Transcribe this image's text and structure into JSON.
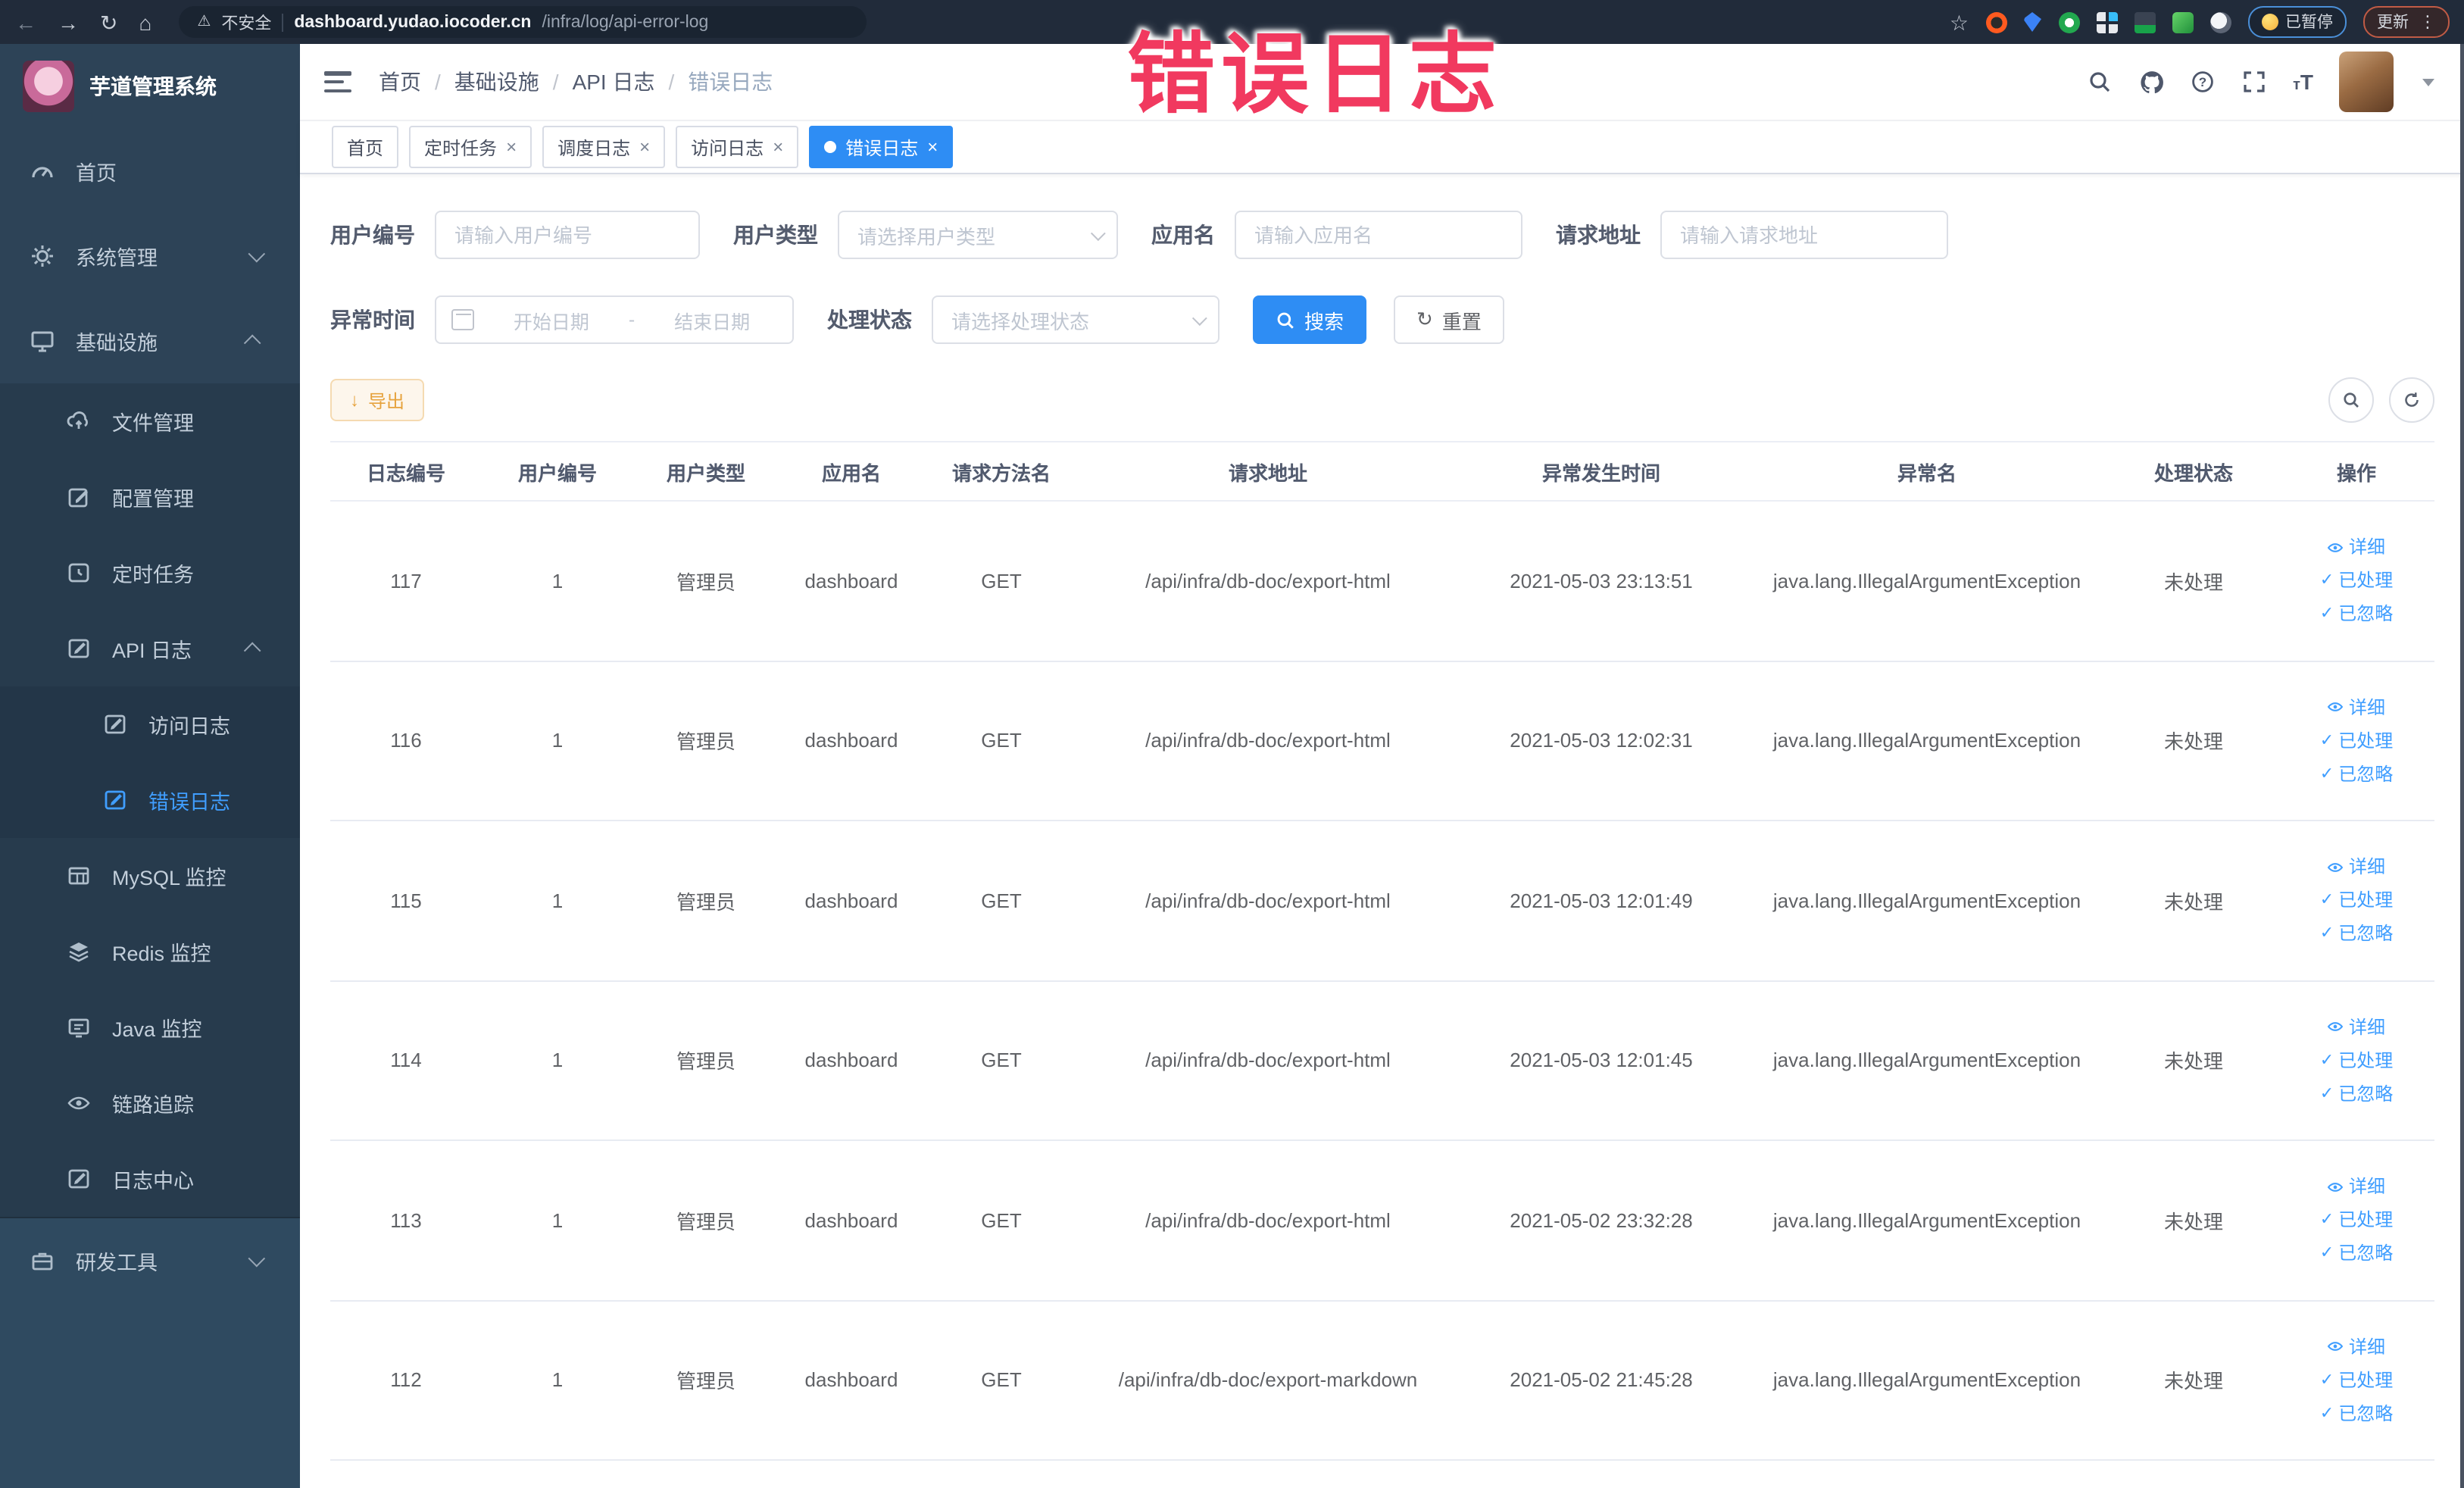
{
  "browser": {
    "security_label": "不安全",
    "url_domain": "dashboard.yudao.iocoder.cn",
    "url_path": "/infra/log/api-error-log",
    "back_icon": "←",
    "forward_icon": "→",
    "reload_icon": "↻",
    "home_icon": "⌂",
    "warning_icon": "⚠",
    "star_icon": "☆",
    "paused_label": "已暂停",
    "update_label": "更新",
    "kebab_icon": "⋮"
  },
  "overlay": {
    "title": "错误日志",
    "color": "#f1395f"
  },
  "sidebar": {
    "app_title": "芋道管理系统",
    "logo_icon": "rabbit-logo",
    "items": [
      {
        "label": "首页",
        "icon": "gauge-icon"
      },
      {
        "label": "系统管理",
        "icon": "gear-icon",
        "arrow": "down"
      },
      {
        "label": "基础设施",
        "icon": "monitor-icon",
        "arrow": "up"
      },
      {
        "label": "文件管理",
        "icon": "cloud-upload-icon"
      },
      {
        "label": "配置管理",
        "icon": "edit-icon"
      },
      {
        "label": "定时任务",
        "icon": "timer-icon"
      },
      {
        "label": "API 日志",
        "icon": "log-icon",
        "arrow": "up"
      },
      {
        "label": "访问日志",
        "icon": "log-icon"
      },
      {
        "label": "错误日志",
        "icon": "log-icon",
        "active": true
      },
      {
        "label": "MySQL 监控",
        "icon": "table-icon"
      },
      {
        "label": "Redis 监控",
        "icon": "layers-icon"
      },
      {
        "label": "Java 监控",
        "icon": "display-icon"
      },
      {
        "label": "链路追踪",
        "icon": "eye-icon"
      },
      {
        "label": "日志中心",
        "icon": "log-icon"
      },
      {
        "label": "研发工具",
        "icon": "briefcase-icon",
        "arrow": "down"
      }
    ]
  },
  "breadcrumb": {
    "separator": "/",
    "items": [
      "首页",
      "基础设施",
      "API 日志",
      "错误日志"
    ]
  },
  "tags": [
    {
      "label": "首页"
    },
    {
      "label": "定时任务",
      "close": "×"
    },
    {
      "label": "调度日志",
      "close": "×"
    },
    {
      "label": "访问日志",
      "close": "×"
    },
    {
      "label": "错误日志",
      "close": "×",
      "active": true
    }
  ],
  "filters": {
    "user_id": {
      "label": "用户编号",
      "placeholder": "请输入用户编号"
    },
    "user_type": {
      "label": "用户类型",
      "placeholder": "请选择用户类型"
    },
    "app_name": {
      "label": "应用名",
      "placeholder": "请输入应用名"
    },
    "request_url": {
      "label": "请求地址",
      "placeholder": "请输入请求地址"
    },
    "exception_time": {
      "label": "异常时间",
      "start_placeholder": "开始日期",
      "separator": "-",
      "end_placeholder": "结束日期"
    },
    "process_status": {
      "label": "处理状态",
      "placeholder": "请选择处理状态"
    },
    "search_label": "搜索",
    "reset_label": "重置"
  },
  "toolbar": {
    "export_label": "导出",
    "export_icon": "↓",
    "reset_icon": "↻"
  },
  "table": {
    "columns": [
      "日志编号",
      "用户编号",
      "用户类型",
      "应用名",
      "请求方法名",
      "请求地址",
      "异常发生时间",
      "异常名",
      "处理状态",
      "操作"
    ],
    "actions": {
      "detail": "详细",
      "processed": "已处理",
      "ignored": "已忽略",
      "check_icon": "✓"
    },
    "rows": [
      {
        "id": "117",
        "user_id": "1",
        "user_type": "管理员",
        "app_name": "dashboard",
        "method": "GET",
        "url": "/api/infra/db-doc/export-html",
        "time": "2021-05-03 23:13:51",
        "exception": "java.lang.IllegalArgumentException",
        "status": "未处理"
      },
      {
        "id": "116",
        "user_id": "1",
        "user_type": "管理员",
        "app_name": "dashboard",
        "method": "GET",
        "url": "/api/infra/db-doc/export-html",
        "time": "2021-05-03 12:02:31",
        "exception": "java.lang.IllegalArgumentException",
        "status": "未处理"
      },
      {
        "id": "115",
        "user_id": "1",
        "user_type": "管理员",
        "app_name": "dashboard",
        "method": "GET",
        "url": "/api/infra/db-doc/export-html",
        "time": "2021-05-03 12:01:49",
        "exception": "java.lang.IllegalArgumentException",
        "status": "未处理"
      },
      {
        "id": "114",
        "user_id": "1",
        "user_type": "管理员",
        "app_name": "dashboard",
        "method": "GET",
        "url": "/api/infra/db-doc/export-html",
        "time": "2021-05-03 12:01:45",
        "exception": "java.lang.IllegalArgumentException",
        "status": "未处理"
      },
      {
        "id": "113",
        "user_id": "1",
        "user_type": "管理员",
        "app_name": "dashboard",
        "method": "GET",
        "url": "/api/infra/db-doc/export-html",
        "time": "2021-05-02 23:32:28",
        "exception": "java.lang.IllegalArgumentException",
        "status": "未处理"
      },
      {
        "id": "112",
        "user_id": "1",
        "user_type": "管理员",
        "app_name": "dashboard",
        "method": "GET",
        "url": "/api/infra/db-doc/export-markdown",
        "time": "2021-05-02 21:45:28",
        "exception": "java.lang.IllegalArgumentException",
        "status": "未处理"
      }
    ]
  },
  "colors": {
    "accent": "#2e8df4",
    "link": "#409eff",
    "warning": "#e6a23c",
    "sidebar_bg": "#2d4357",
    "overlay_pink": "#f1395f"
  }
}
